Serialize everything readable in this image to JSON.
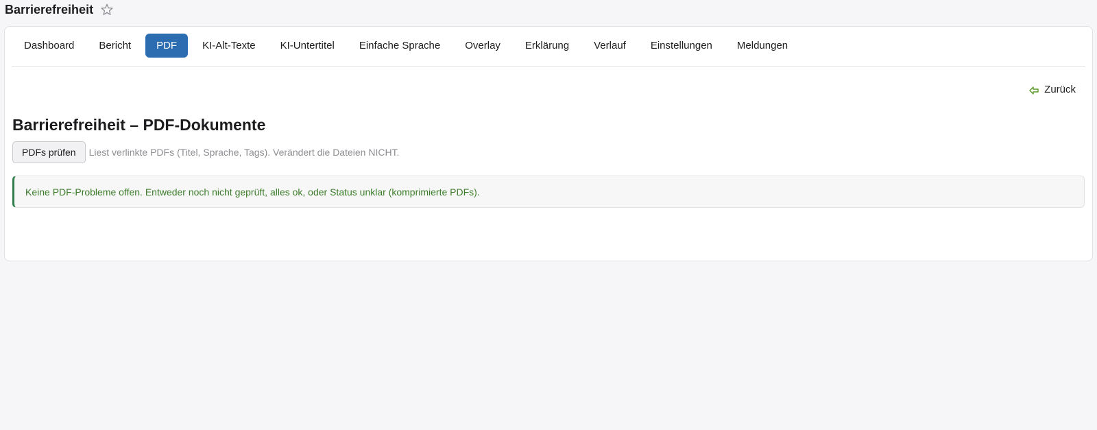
{
  "page": {
    "title": "Barrierefreiheit",
    "favorite_icon": "star-outline-icon"
  },
  "tabs": [
    {
      "label": "Dashboard",
      "active": false
    },
    {
      "label": "Bericht",
      "active": false
    },
    {
      "label": "PDF",
      "active": true
    },
    {
      "label": "KI-Alt-Texte",
      "active": false
    },
    {
      "label": "KI-Untertitel",
      "active": false
    },
    {
      "label": "Einfache Sprache",
      "active": false
    },
    {
      "label": "Overlay",
      "active": false
    },
    {
      "label": "Erklärung",
      "active": false
    },
    {
      "label": "Verlauf",
      "active": false
    },
    {
      "label": "Einstellungen",
      "active": false
    },
    {
      "label": "Meldungen",
      "active": false
    }
  ],
  "back_link": {
    "label": "Zurück",
    "icon": "arrow-left-icon",
    "icon_color": "#5a9a2a"
  },
  "section": {
    "title": "Barrierefreiheit – PDF-Dokumente",
    "check_button_label": "PDFs prüfen",
    "hint": "Liest verlinkte PDFs (Titel, Sprache, Tags). Verändert die Dateien NICHT."
  },
  "notice": {
    "message": "Keine PDF-Probleme offen. Entweder noch nicht geprüft, alles ok, oder Status unklar (komprimierte PDFs).",
    "text_color": "#3c7b2b",
    "accent_color": "#2f7d4a"
  },
  "colors": {
    "active_tab": "#2c6db2",
    "background": "#f6f6f8"
  }
}
